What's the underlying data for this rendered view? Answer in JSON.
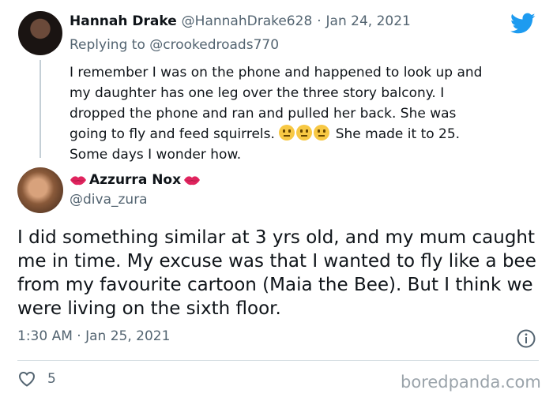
{
  "parent_tweet": {
    "display_name": "Hannah Drake",
    "handle": "@HannahDrake628",
    "separator": "·",
    "date": "Jan 24, 2021",
    "replying_prefix": "Replying to",
    "replying_to": "@crookedroads770",
    "text_before_emoji": "I remember I was on the phone and happened to look up and\nmy daughter has one leg over the three story balcony. I\ndropped the phone and ran and pulled her back. She was\ngoing to fly and feed squirrels. ",
    "emoji": [
      "neutral-face",
      "neutral-face",
      "neutral-face"
    ],
    "text_after_emoji": " She made it to 25.\nSome days I wonder how."
  },
  "main_tweet": {
    "display_name": "Azzurra Nox",
    "name_emoji": "kiss-mark",
    "handle": "@diva_zura",
    "text": "I did something similar at 3 yrs old, and my mum caught me in time. My excuse was that I wanted to fly like a bee from my favourite cartoon (Maia the Bee). But I think we were living on the sixth floor.",
    "timestamp": "1:30 AM · Jan 25, 2021",
    "like_count": "5"
  },
  "branding": {
    "platform_icon": "twitter-bird-icon",
    "accent_color": "#1d9bf0",
    "watermark": "boredpanda.com"
  }
}
